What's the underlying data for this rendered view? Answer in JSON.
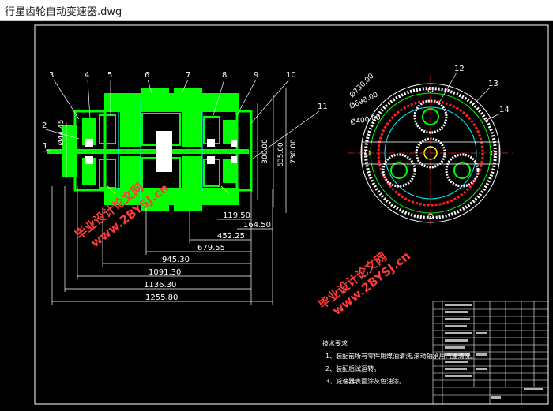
{
  "window": {
    "title": "行星齿轮自动变速器.dwg"
  },
  "drawing": {
    "part_numbers": [
      "1",
      "2",
      "3",
      "4",
      "5",
      "6",
      "7",
      "8",
      "9",
      "10",
      "11",
      "12",
      "13",
      "14"
    ],
    "side_view_dims": {
      "dia_small": "Ø44.45",
      "height_1": "300.00",
      "height_2": "635.00",
      "height_3": "730.00"
    },
    "horizontal_dims": [
      "119.50",
      "164.50",
      "452.25",
      "679.55",
      "945.30",
      "1091.30",
      "1136.30",
      "1255.80"
    ],
    "front_view_dims": [
      "Ø730.00",
      "Ø698.00",
      "Ø400.00"
    ],
    "watermark": {
      "line1": "毕业设计论文网",
      "line2": "www.2BYSJ.cn"
    },
    "notes": {
      "heading": "技术要求",
      "items": [
        "1、装配前所有零件用煤油清洗,滚动轴承用汽油清洗。",
        "2、装配后试运转。",
        "3、减速器表面涂灰色油漆。"
      ]
    }
  },
  "colors": {
    "background": "#000000",
    "green": "#00ff00",
    "white": "#ffffff",
    "red": "#ff2020",
    "cyan": "#00ffff",
    "yellow": "#ffff00",
    "watermark": "#ff3b3b"
  }
}
